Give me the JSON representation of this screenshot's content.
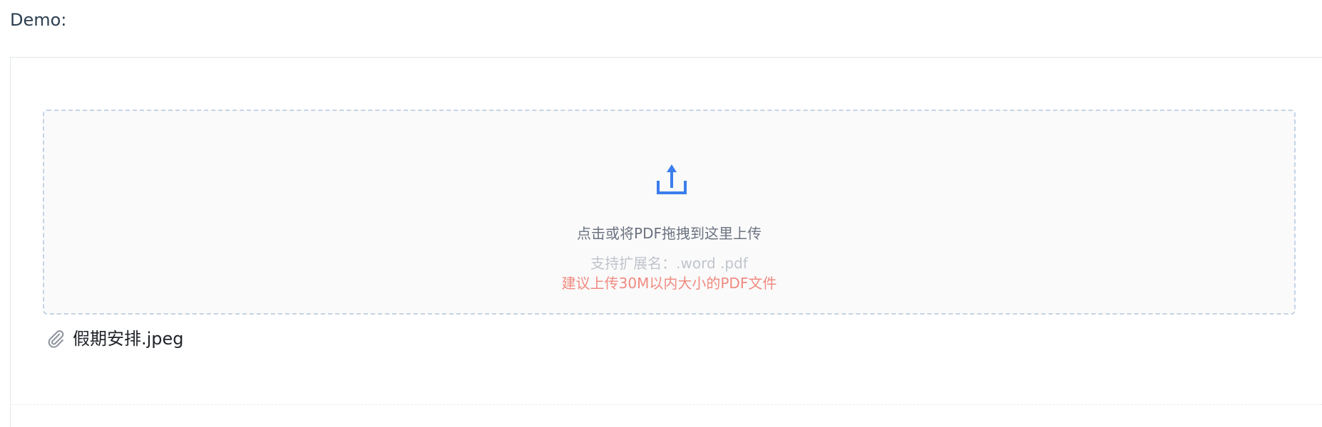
{
  "page": {
    "heading": "Demo:"
  },
  "upload": {
    "icon": "upload-icon",
    "main_text": "点击或将PDF拖拽到这里上传",
    "tip_extensions": "支持扩展名：.word .pdf",
    "tip_size": "建议上传30M以内大小的PDF文件",
    "accent_color": "#3b7ded",
    "tip_warning_color": "#f08a80"
  },
  "files": [
    {
      "icon": "paperclip-icon",
      "name": "假期安排.jpeg"
    }
  ]
}
